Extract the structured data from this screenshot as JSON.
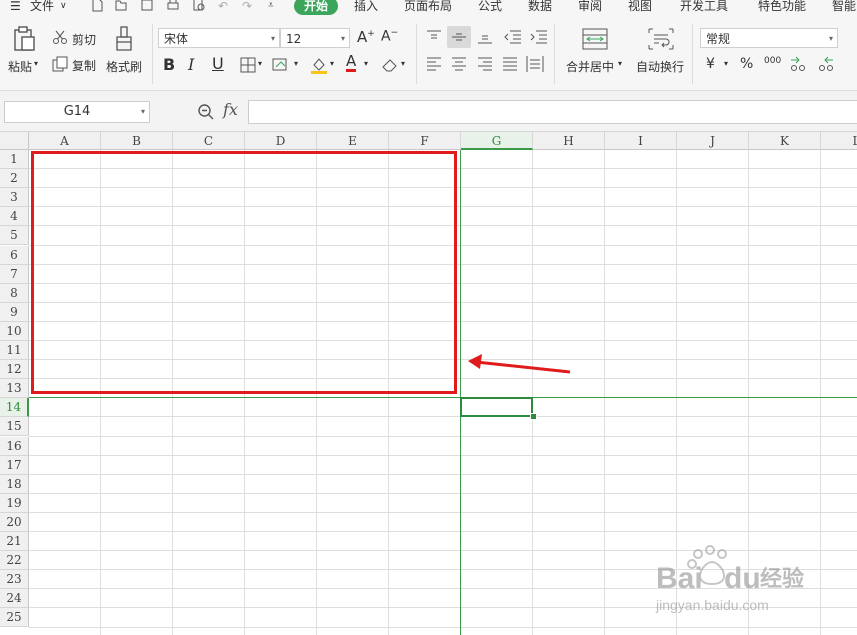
{
  "menu": {
    "file": "文件",
    "tabs": [
      "开始",
      "插入",
      "页面布局",
      "公式",
      "数据",
      "审阅",
      "视图",
      "开发工具",
      "特色功能",
      "智能"
    ]
  },
  "ribbon": {
    "paste": "粘贴",
    "cut": "剪切",
    "copy": "复制",
    "format_painter": "格式刷",
    "font_name": "宋体",
    "font_size": "12",
    "merge_center": "合并居中",
    "wrap_text": "自动换行",
    "number_format": "常规",
    "currency": "¥",
    "percent": "%",
    "thousands": "000"
  },
  "formula_bar": {
    "cell_ref": "G14",
    "fx": "fx",
    "value": ""
  },
  "columns": [
    "A",
    "B",
    "C",
    "D",
    "E",
    "F",
    "G",
    "H",
    "I",
    "J",
    "K",
    "L"
  ],
  "rows": [
    "1",
    "2",
    "3",
    "4",
    "5",
    "6",
    "7",
    "8",
    "9",
    "10",
    "11",
    "12",
    "13",
    "14",
    "15",
    "16",
    "17",
    "18",
    "19",
    "20",
    "21",
    "22",
    "23",
    "24",
    "25"
  ],
  "selection": {
    "column": "G",
    "row": "14"
  },
  "annotation": {
    "box_color": "#e01b1b",
    "range": "A1:F13"
  },
  "watermark": {
    "brand": "Bai",
    "brand2": "du",
    "cn": "经验",
    "url": "jingyan.baidu.com"
  },
  "colors": {
    "accent": "#3ba55c",
    "selection": "#2e8b3e",
    "annotation": "#e01b1b"
  }
}
